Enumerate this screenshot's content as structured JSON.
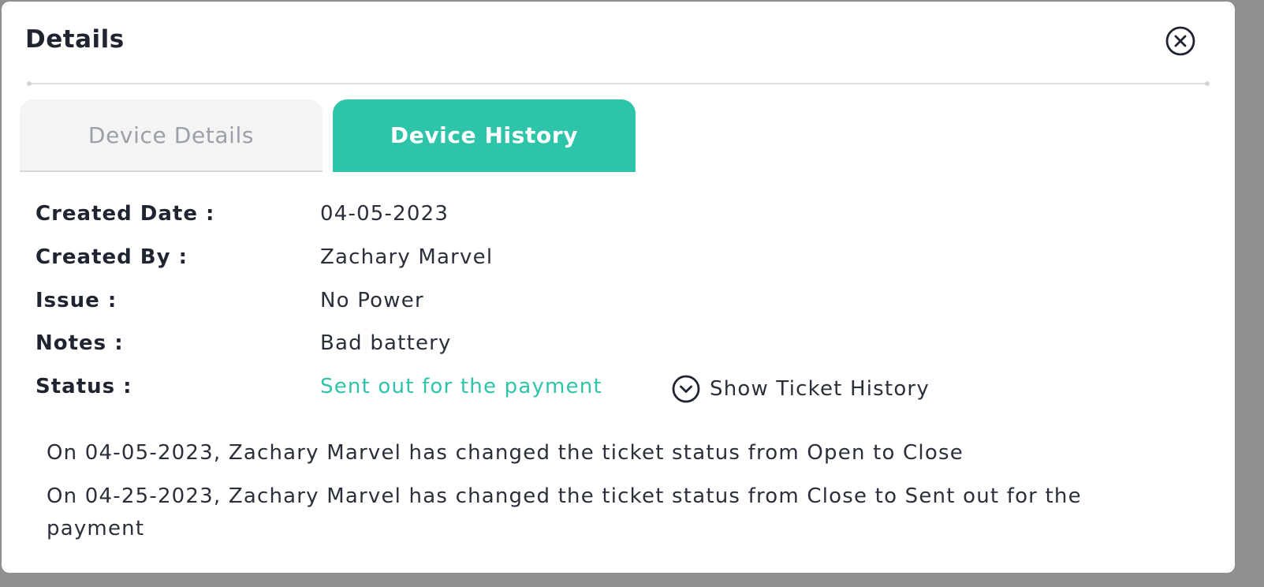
{
  "modal": {
    "title": "Details",
    "close_icon": "close-circle-icon"
  },
  "tabs": [
    {
      "label": "Device Details",
      "active": false
    },
    {
      "label": "Device History",
      "active": true
    }
  ],
  "fields": [
    {
      "label": "Created Date :",
      "value": "04-05-2023"
    },
    {
      "label": "Created By :",
      "value": "Zachary Marvel"
    },
    {
      "label": "Issue :",
      "value": "No Power"
    },
    {
      "label": "Notes :",
      "value": "Bad battery"
    },
    {
      "label": "Status :",
      "value": "Sent out for the payment"
    }
  ],
  "ticket_history": {
    "toggle_label": "Show Ticket History",
    "toggle_icon": "chevron-down-circle-icon",
    "entries": [
      "On 04-05-2023, Zachary Marvel has changed the ticket status from Open to Close",
      "On 04-25-2023, Zachary Marvel has changed the ticket status from Close to Sent out for the payment"
    ]
  },
  "colors": {
    "accent": "#2ec4a9",
    "text_dark": "#1f2430",
    "tab_inactive_bg": "#f4f4f5",
    "tab_inactive_text": "#9aa0a6"
  }
}
